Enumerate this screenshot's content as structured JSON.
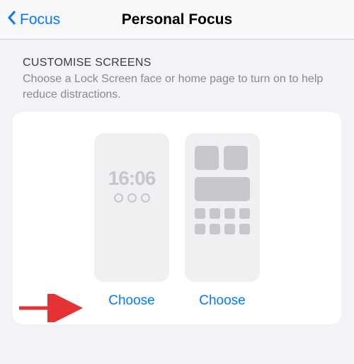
{
  "header": {
    "back_label": "Focus",
    "title": "Personal Focus"
  },
  "section": {
    "title": "CUSTOMISE SCREENS",
    "subtitle": "Choose a Lock Screen face or home page to turn on to help reduce distractions."
  },
  "lockScreen": {
    "time": "16:06",
    "choose_label": "Choose"
  },
  "homeScreen": {
    "choose_label": "Choose"
  }
}
